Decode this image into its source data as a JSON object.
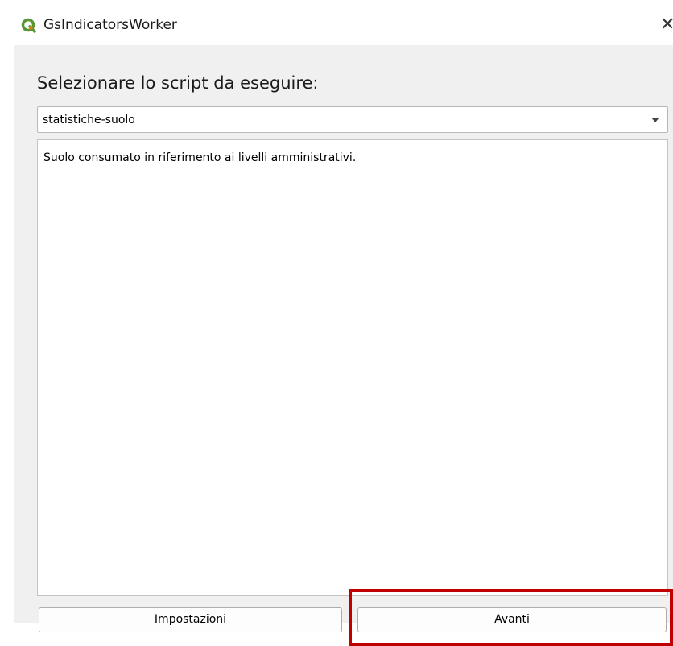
{
  "window": {
    "title": "GsIndicatorsWorker",
    "close_glyph": "✕"
  },
  "main": {
    "heading": "Selezionare lo script da eseguire:",
    "script_select": {
      "selected_value": "statistiche-suolo"
    },
    "description": "Suolo consumato in riferimento ai livelli amministrativi."
  },
  "buttons": {
    "settings_label": "Impostazioni",
    "next_label": "Avanti"
  },
  "icons": {
    "app": "qgis-logo-icon",
    "close": "close-icon",
    "dropdown": "chevron-down-icon"
  },
  "colors": {
    "highlight": "#c00000",
    "window_bg": "#f0f0f0",
    "qgis_green": "#589632",
    "qgis_yellow": "#ee7913"
  }
}
